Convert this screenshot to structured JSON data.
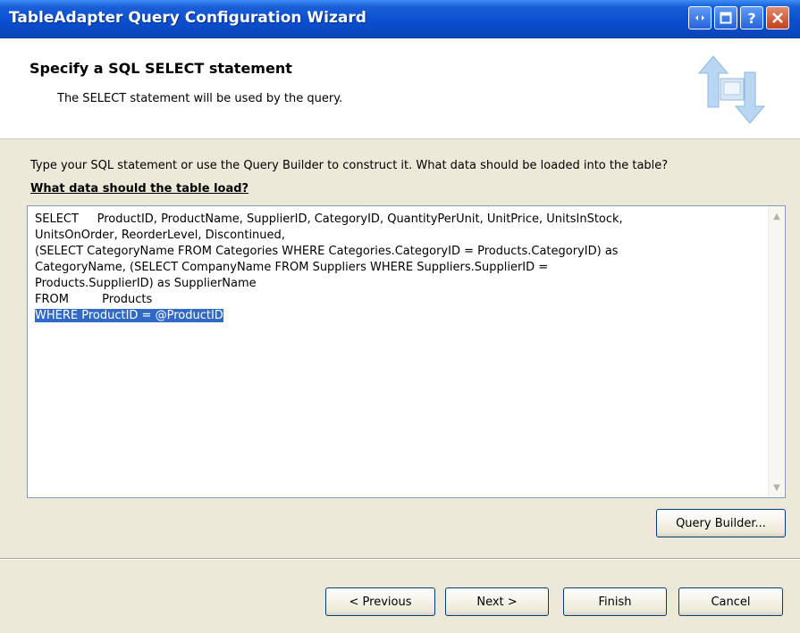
{
  "window": {
    "title": "TableAdapter Query Configuration Wizard",
    "controls": {
      "context_help": "?"
    }
  },
  "header": {
    "title": "Specify a SQL SELECT statement",
    "subtitle": "The SELECT statement will be used by the query."
  },
  "main": {
    "instruction": "Type your SQL statement or use the Query Builder to construct it. What data should be loaded into the table?",
    "question_label": "What data should the table load?",
    "sql_lines": [
      "SELECT     ProductID, ProductName, SupplierID, CategoryID, QuantityPerUnit, UnitPrice, UnitsInStock,",
      "UnitsOnOrder, ReorderLevel, Discontinued,",
      "(SELECT CategoryName FROM Categories WHERE Categories.CategoryID = Products.CategoryID) as",
      "CategoryName, (SELECT CompanyName FROM Suppliers WHERE Suppliers.SupplierID =",
      "Products.SupplierID) as SupplierName",
      "FROM         Products"
    ],
    "sql_selected_line": "WHERE ProductID = @ProductID",
    "query_builder_label": "Query Builder..."
  },
  "footer": {
    "previous_label": "< Previous",
    "next_label": "Next >",
    "finish_label": "Finish",
    "cancel_label": "Cancel"
  },
  "colors": {
    "title_bar": "#0b4fd0",
    "dialog_bg": "#ece9d8",
    "selection": "#316ac5"
  }
}
